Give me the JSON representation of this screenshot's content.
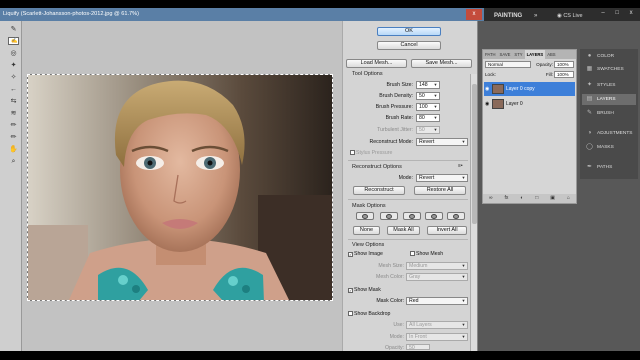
{
  "app": {
    "dialog_title": "Liquify (Scarlett-Johansson-photos-2012.jpg @ 61.7%)",
    "close_glyph": "x",
    "workspace": "PAINTING",
    "workspace_more": "»",
    "cs_live": "CS Live",
    "window_controls": [
      "–",
      "□",
      "x"
    ]
  },
  "tools": [
    {
      "name": "forward-warp-tool",
      "glyph": "✎",
      "selected": false
    },
    {
      "name": "reconstruct-tool",
      "glyph": "✍",
      "selected": true
    },
    {
      "name": "twirl-tool",
      "glyph": "◎",
      "selected": false
    },
    {
      "name": "pucker-tool",
      "glyph": "✦",
      "selected": false
    },
    {
      "name": "bloat-tool",
      "glyph": "✧",
      "selected": false
    },
    {
      "name": "push-left-tool",
      "glyph": "←",
      "selected": false
    },
    {
      "name": "mirror-tool",
      "glyph": "⇆",
      "selected": false
    },
    {
      "name": "turbulence-tool",
      "glyph": "≋",
      "selected": false
    },
    {
      "name": "freeze-mask-tool",
      "glyph": "✏",
      "selected": false
    },
    {
      "name": "thaw-mask-tool",
      "glyph": "✏",
      "selected": false
    },
    {
      "name": "hand-tool",
      "glyph": "✋",
      "selected": false
    },
    {
      "name": "zoom-tool",
      "glyph": "⌕",
      "selected": false
    }
  ],
  "buttons": {
    "ok": "OK",
    "cancel": "Cancel",
    "load_mesh": "Load Mesh...",
    "save_mesh": "Save Mesh..."
  },
  "tool_options": {
    "heading": "Tool Options",
    "brush_size": {
      "label": "Brush Size:",
      "value": "148"
    },
    "brush_density": {
      "label": "Brush Density:",
      "value": "50"
    },
    "brush_pressure": {
      "label": "Brush Pressure:",
      "value": "100"
    },
    "brush_rate": {
      "label": "Brush Rate:",
      "value": "80"
    },
    "turbulent_jitter": {
      "label": "Turbulent Jitter:",
      "value": "50"
    },
    "reconstruct_mode": {
      "label": "Reconstruct Mode:",
      "value": "Revert"
    },
    "stylus_pressure": "Stylus Pressure"
  },
  "reconstruct_options": {
    "heading": "Reconstruct Options",
    "mode_label": "Mode:",
    "mode_value": "Revert",
    "reconstruct": "Reconstruct",
    "restore_all": "Restore All"
  },
  "mask_options": {
    "heading": "Mask Options",
    "none": "None",
    "mask_all": "Mask All",
    "invert_all": "Invert All"
  },
  "view_options": {
    "heading": "View Options",
    "show_image": "Show Image",
    "show_mesh": "Show Mesh",
    "mesh_size_label": "Mesh Size:",
    "mesh_size_value": "Medium",
    "mesh_color_label": "Mesh Color:",
    "mesh_color_value": "Gray",
    "show_mask": "Show Mask",
    "mask_color_label": "Mask Color:",
    "mask_color_value": "Red",
    "show_backdrop": "Show Backdrop",
    "use_label": "Use:",
    "use_value": "All Layers",
    "mode_label": "Mode:",
    "mode_value": "In Front",
    "opacity_label": "Opacity:",
    "opacity_value": "50"
  },
  "layers_panel": {
    "tabs": [
      "PATH",
      "SAVE",
      "STY",
      "LAYERS",
      "ABS"
    ],
    "blend_mode": "Normal",
    "opacity_label": "Opacity:",
    "opacity_value": "100%",
    "lock_label": "Lock:",
    "fill_label": "Fill:",
    "fill_value": "100%",
    "layers": [
      {
        "name": "Layer 0 copy",
        "active": true
      },
      {
        "name": "Layer 0",
        "active": false
      }
    ],
    "footer_icons": [
      "∞",
      "fx",
      "◐",
      "□",
      "▣",
      "⌂"
    ]
  },
  "dock": [
    {
      "label": "COLOR",
      "icon": "●",
      "active": false
    },
    {
      "label": "SWATCHES",
      "icon": "▦",
      "active": false
    },
    {
      "label": "STYLES",
      "icon": "✦",
      "active": false
    },
    {
      "label": "LAYERS",
      "icon": "▤",
      "active": true
    },
    {
      "label": "BRUSH",
      "icon": "✎",
      "active": false
    },
    {
      "label": "ADJUSTMENTS",
      "icon": "◑",
      "active": false
    },
    {
      "label": "MASKS",
      "icon": "◯",
      "active": false
    },
    {
      "label": "PATHS",
      "icon": "✒",
      "active": false
    }
  ]
}
